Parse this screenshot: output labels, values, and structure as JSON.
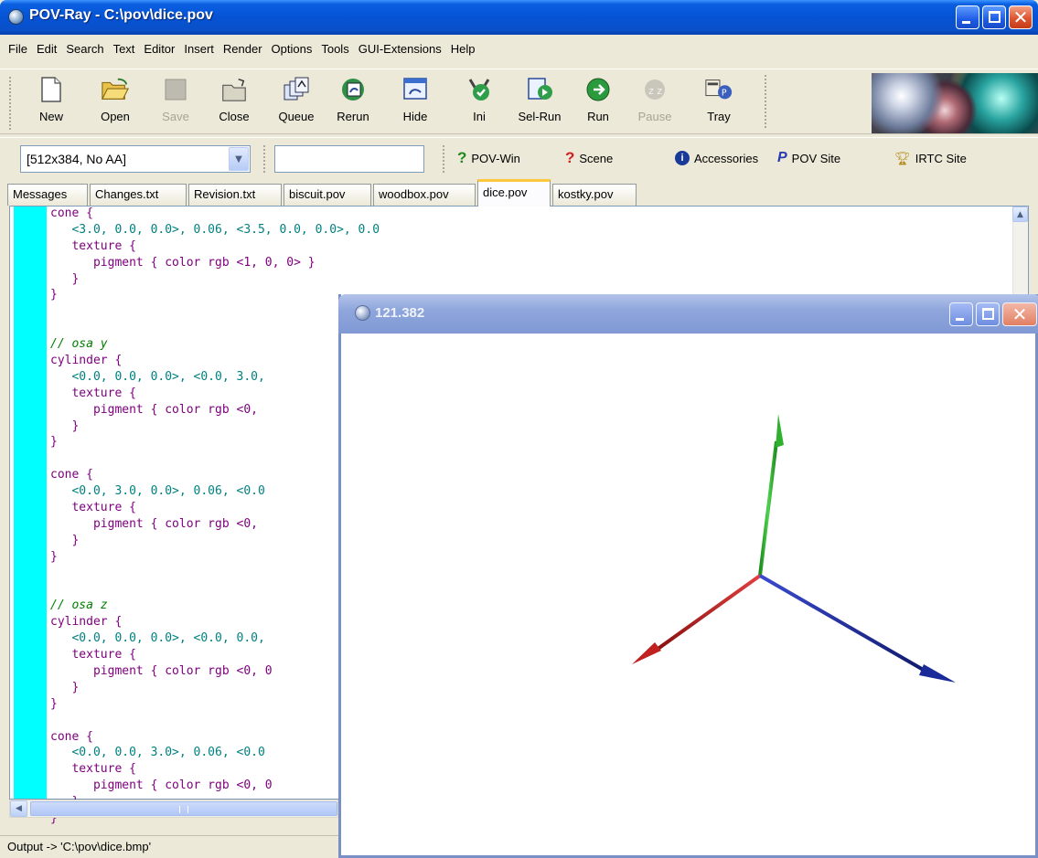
{
  "window": {
    "title": "POV-Ray - C:\\pov\\dice.pov"
  },
  "menu": [
    "File",
    "Edit",
    "Search",
    "Text",
    "Editor",
    "Insert",
    "Render",
    "Options",
    "Tools",
    "GUI-Extensions",
    "Help"
  ],
  "toolbar": {
    "new_label": "New",
    "open_label": "Open",
    "save_label": "Save",
    "close_label": "Close",
    "queue_label": "Queue",
    "rerun_label": "Rerun",
    "hide_label": "Hide",
    "ini_label": "Ini",
    "selrun_label": "Sel-Run",
    "run_label": "Run",
    "pause_label": "Pause",
    "tray_label": "Tray"
  },
  "bar2": {
    "resolution_value": "[512x384, No AA]",
    "command_value": "",
    "povwin_label": "POV-Win",
    "scene_label": "Scene",
    "accessories_label": "Accessories",
    "povsite_label": "POV Site",
    "irtc_label": "IRTC Site"
  },
  "tabs": [
    {
      "label": "Messages"
    },
    {
      "label": "Changes.txt"
    },
    {
      "label": "Revision.txt"
    },
    {
      "label": "biscuit.pov"
    },
    {
      "label": "woodbox.pov"
    },
    {
      "label": "dice.pov"
    },
    {
      "label": "kostky.pov"
    }
  ],
  "active_tab": "dice.pov",
  "editor": {
    "lines": [
      {
        "cls": "kw",
        "text": "cone {"
      },
      {
        "cls": "num",
        "text": "   <3.0, 0.0, 0.0>, 0.06, <3.5, 0.0, 0.0>, 0.0"
      },
      {
        "cls": "kw",
        "text": "   texture {"
      },
      {
        "cls": "kw",
        "text": "      pigment { color rgb <1, 0, 0> }"
      },
      {
        "cls": "kw",
        "text": "   }"
      },
      {
        "cls": "kw",
        "text": "}"
      },
      {
        "cls": "",
        "text": ""
      },
      {
        "cls": "",
        "text": ""
      },
      {
        "cls": "cm",
        "text": "// osa y"
      },
      {
        "cls": "kw",
        "text": "cylinder {"
      },
      {
        "cls": "num",
        "text": "   <0.0, 0.0, 0.0>, <0.0, 3.0,"
      },
      {
        "cls": "kw",
        "text": "   texture {"
      },
      {
        "cls": "kw",
        "text": "      pigment { color rgb <0, "
      },
      {
        "cls": "kw",
        "text": "   }"
      },
      {
        "cls": "kw",
        "text": "}"
      },
      {
        "cls": "",
        "text": ""
      },
      {
        "cls": "kw",
        "text": "cone {"
      },
      {
        "cls": "num",
        "text": "   <0.0, 3.0, 0.0>, 0.06, <0.0"
      },
      {
        "cls": "kw",
        "text": "   texture {"
      },
      {
        "cls": "kw",
        "text": "      pigment { color rgb <0, "
      },
      {
        "cls": "kw",
        "text": "   }"
      },
      {
        "cls": "kw",
        "text": "}"
      },
      {
        "cls": "",
        "text": ""
      },
      {
        "cls": "",
        "text": ""
      },
      {
        "cls": "cm",
        "text": "// osa z"
      },
      {
        "cls": "kw",
        "text": "cylinder {"
      },
      {
        "cls": "num",
        "text": "   <0.0, 0.0, 0.0>, <0.0, 0.0,"
      },
      {
        "cls": "kw",
        "text": "   texture {"
      },
      {
        "cls": "kw",
        "text": "      pigment { color rgb <0, 0"
      },
      {
        "cls": "kw",
        "text": "   }"
      },
      {
        "cls": "kw",
        "text": "}"
      },
      {
        "cls": "",
        "text": ""
      },
      {
        "cls": "kw",
        "text": "cone {"
      },
      {
        "cls": "num",
        "text": "   <0.0, 0.0, 3.0>, 0.06, <0.0"
      },
      {
        "cls": "kw",
        "text": "   texture {"
      },
      {
        "cls": "kw",
        "text": "      pigment { color rgb <0, 0"
      },
      {
        "cls": "kw",
        "text": "   }"
      },
      {
        "cls": "kw",
        "text": "}"
      }
    ]
  },
  "status": {
    "text": "Output -> 'C:\\pov\\dice.bmp'"
  },
  "render_window": {
    "title": "121.382",
    "axis_colors": {
      "x": "#cc2222",
      "y": "#22aa22",
      "z": "#1a2a99"
    }
  },
  "colors": {
    "titlebar": "#0553d5",
    "gutter": "#00ffff",
    "render_titlebar": "#8fa6dc"
  }
}
